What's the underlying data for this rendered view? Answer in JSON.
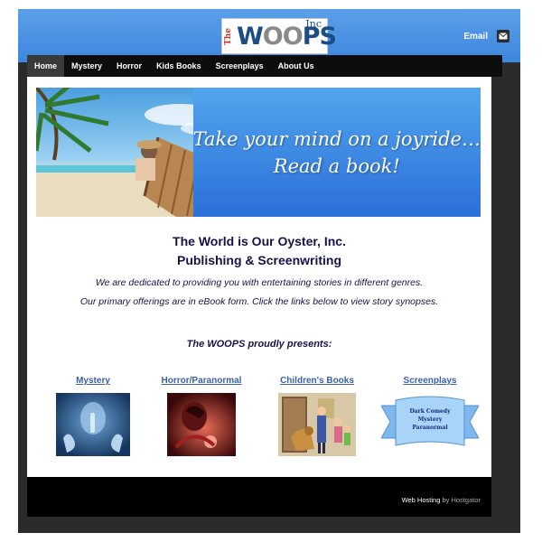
{
  "header": {
    "logo": {
      "the": "The",
      "woops_w": "W",
      "woops_oo": "OO",
      "woops_ps": "PS",
      "inc": "Inc"
    },
    "email_label": "Email",
    "gradient_top": "#5a9fe8",
    "gradient_bottom": "#3d87e0"
  },
  "nav": {
    "items": [
      {
        "label": "Home",
        "active": true
      },
      {
        "label": "Mystery"
      },
      {
        "label": "Horror"
      },
      {
        "label": "Kids Books"
      },
      {
        "label": "Screenplays"
      },
      {
        "label": "About Us"
      }
    ]
  },
  "hero": {
    "tagline_line1": "Take your mind on a joyride…",
    "tagline_line2": "Read a book!"
  },
  "intro": {
    "title_line1": "The World is Our Oyster, Inc.",
    "title_line2": "Publishing & Screenwriting",
    "line1": "We are dedicated to providing you with entertaining stories in different genres.",
    "line2": "Our primary offerings are in eBook form. Click the links below to view story synopses.",
    "presents": "The WOOPS proudly presents:"
  },
  "categories": [
    {
      "label": "Mystery"
    },
    {
      "label": "Horror/Paranormal"
    },
    {
      "label": "Children's Books"
    },
    {
      "label": "Screenplays",
      "ribbon_text": [
        "Dark Comedy",
        "Mystery",
        "Paranormal"
      ]
    }
  ],
  "footer": {
    "hosting_label": "Web Hosting",
    "by_label": "by Hostgator"
  },
  "colors": {
    "accent_blue": "#3d87e0",
    "heading_navy": "#13134a",
    "link_blue": "#3b5fa8"
  }
}
